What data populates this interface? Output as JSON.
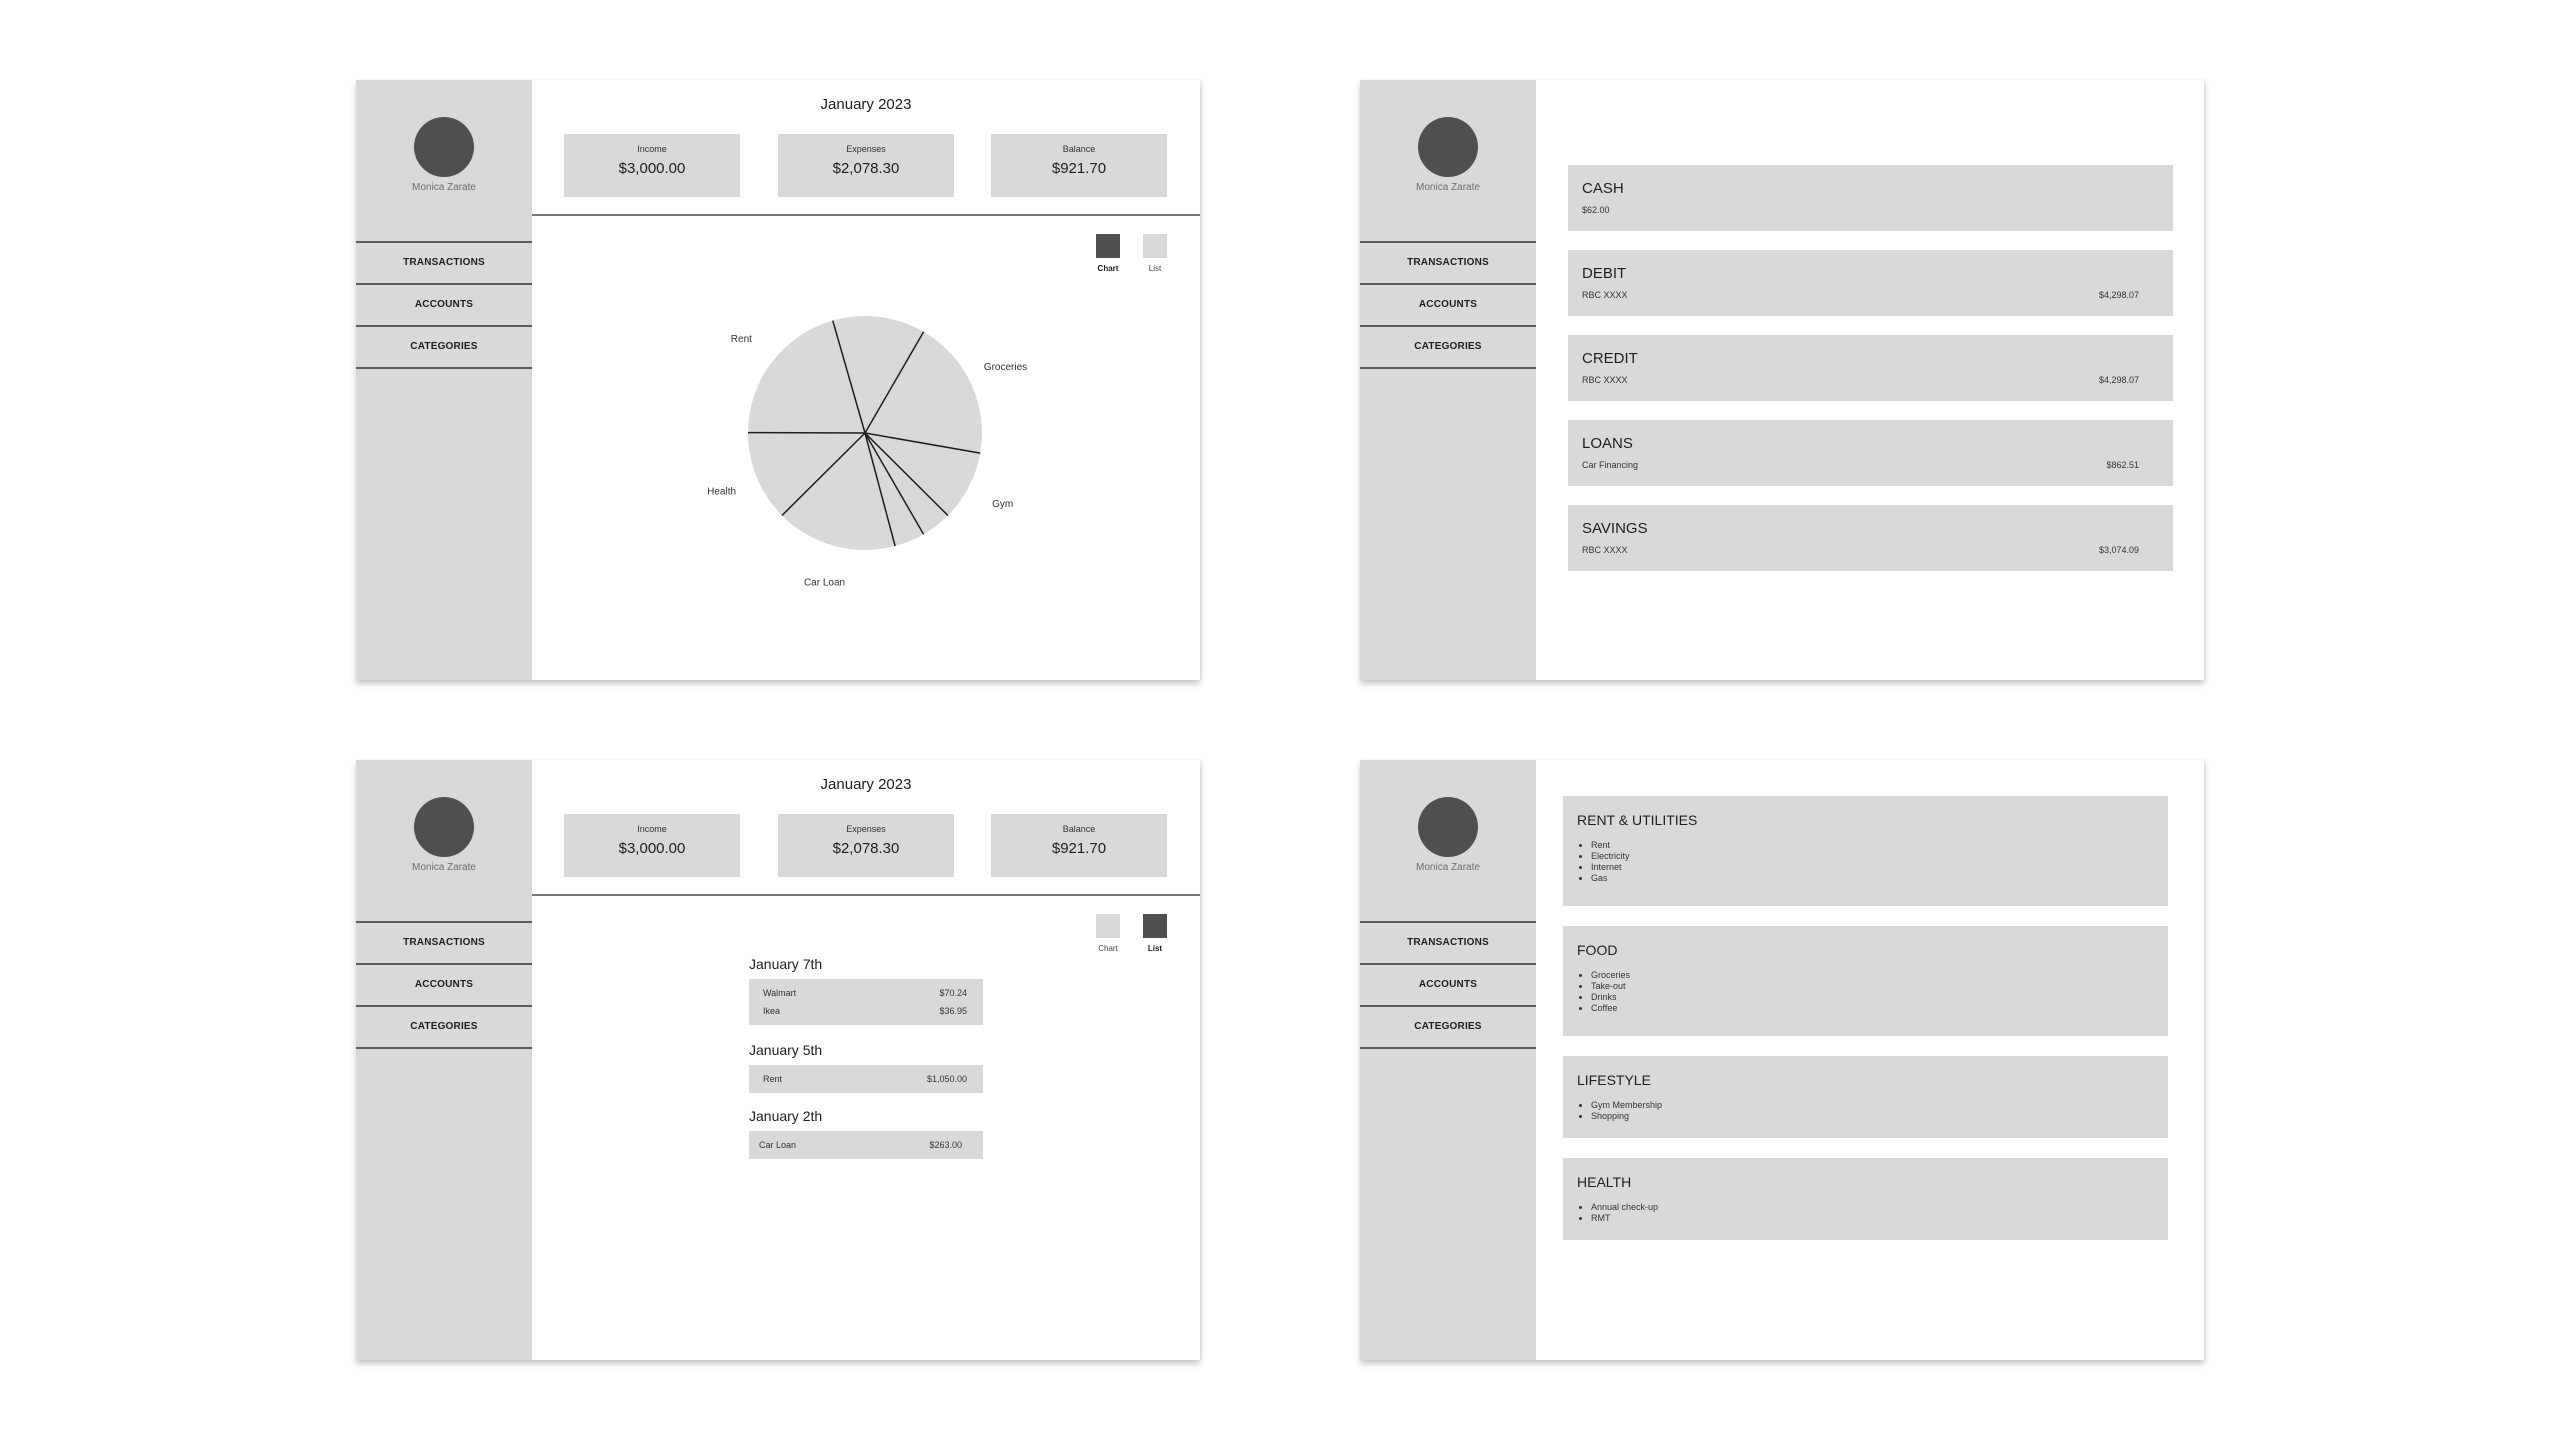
{
  "user": {
    "name": "Monica Zarate"
  },
  "nav": [
    "TRANSACTIONS",
    "ACCOUNTS",
    "CATEGORIES"
  ],
  "transactions": {
    "month": "January 2023",
    "summary": [
      {
        "label": "Income",
        "value": "$3,000.00"
      },
      {
        "label": "Expenses",
        "value": "$2,078.30"
      },
      {
        "label": "Balance",
        "value": "$921.70"
      }
    ],
    "toggle": {
      "chart": "Chart",
      "list": "List"
    },
    "list_groups": [
      {
        "date": "January 7th",
        "items": [
          {
            "name": "Walmart",
            "amount": "$70.24"
          },
          {
            "name": "Ikea",
            "amount": "$36.95"
          }
        ]
      },
      {
        "date": "January 5th",
        "items": [
          {
            "name": "Rent",
            "amount": "$1,050.00"
          }
        ]
      },
      {
        "date": "January 2th",
        "items": [
          {
            "name": "Car Loan",
            "amount": "$263.00"
          }
        ]
      }
    ]
  },
  "chart_data": {
    "type": "pie",
    "title": "",
    "start_angle_deg": 344,
    "slices": [
      {
        "label": "",
        "percent": 12.8
      },
      {
        "label": "Groceries",
        "percent": 19.4
      },
      {
        "label": "Gym",
        "percent": 9.7
      },
      {
        "label": "",
        "percent": 4.2
      },
      {
        "label": "",
        "percent": 4.2
      },
      {
        "label": "Car Loan",
        "percent": 16.7
      },
      {
        "label": "Health",
        "percent": 12.5
      },
      {
        "label": "Rent",
        "percent": 20.5
      }
    ],
    "colors": {
      "fill": "#d9d9d9",
      "stroke": "#1e1e1e"
    }
  },
  "accounts": {
    "add_label": "+",
    "items": [
      {
        "title": "CASH",
        "sub": "$62.00",
        "amount": ""
      },
      {
        "title": "DEBIT",
        "sub": "RBC XXXX",
        "amount": "$4,298.07"
      },
      {
        "title": "CREDIT",
        "sub": "RBC XXXX",
        "amount": "$4,298.07"
      },
      {
        "title": "LOANS",
        "sub": "Car Financing",
        "amount": "$862.51"
      },
      {
        "title": "SAVINGS",
        "sub": "RBC XXXX",
        "amount": "$3,074.09"
      }
    ]
  },
  "categories": [
    {
      "title": "RENT & UTILITIES",
      "items": [
        "Rent",
        "Electricity",
        "Internet",
        "Gas"
      ]
    },
    {
      "title": "FOOD",
      "items": [
        "Groceries",
        "Take-out",
        "Drinks",
        "Coffee"
      ]
    },
    {
      "title": "LIFESTYLE",
      "items": [
        "Gym Membership",
        "Shopping"
      ]
    },
    {
      "title": "HEALTH",
      "items": [
        "Annual check-up",
        "RMT"
      ]
    }
  ],
  "theme": {
    "card": "#d9d9d9",
    "avatar": "#4f4f4f",
    "active_toggle": "#4f4f4f"
  }
}
